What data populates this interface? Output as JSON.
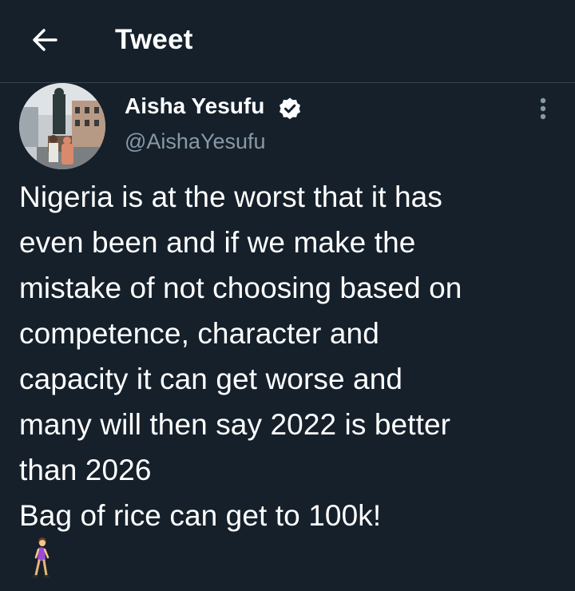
{
  "header": {
    "title": "Tweet",
    "back_icon": "arrow-left-icon"
  },
  "author": {
    "display_name": "Aisha Yesufu",
    "handle": "@AishaYesufu",
    "verified": true
  },
  "tweet": {
    "text": "Nigeria is at the worst that it has\neven been and if we make the\nmistake of not choosing based on\ncompetence, character and\ncapacity it can get worse and\nmany will then say 2022 is better\nthan 2026\nBag of rice can get to 100k!",
    "emoji": "woman-walking-emoji"
  },
  "colors": {
    "background": "#15202b",
    "text": "#ffffff",
    "secondary": "#8899a6",
    "divider": "#38444d"
  }
}
